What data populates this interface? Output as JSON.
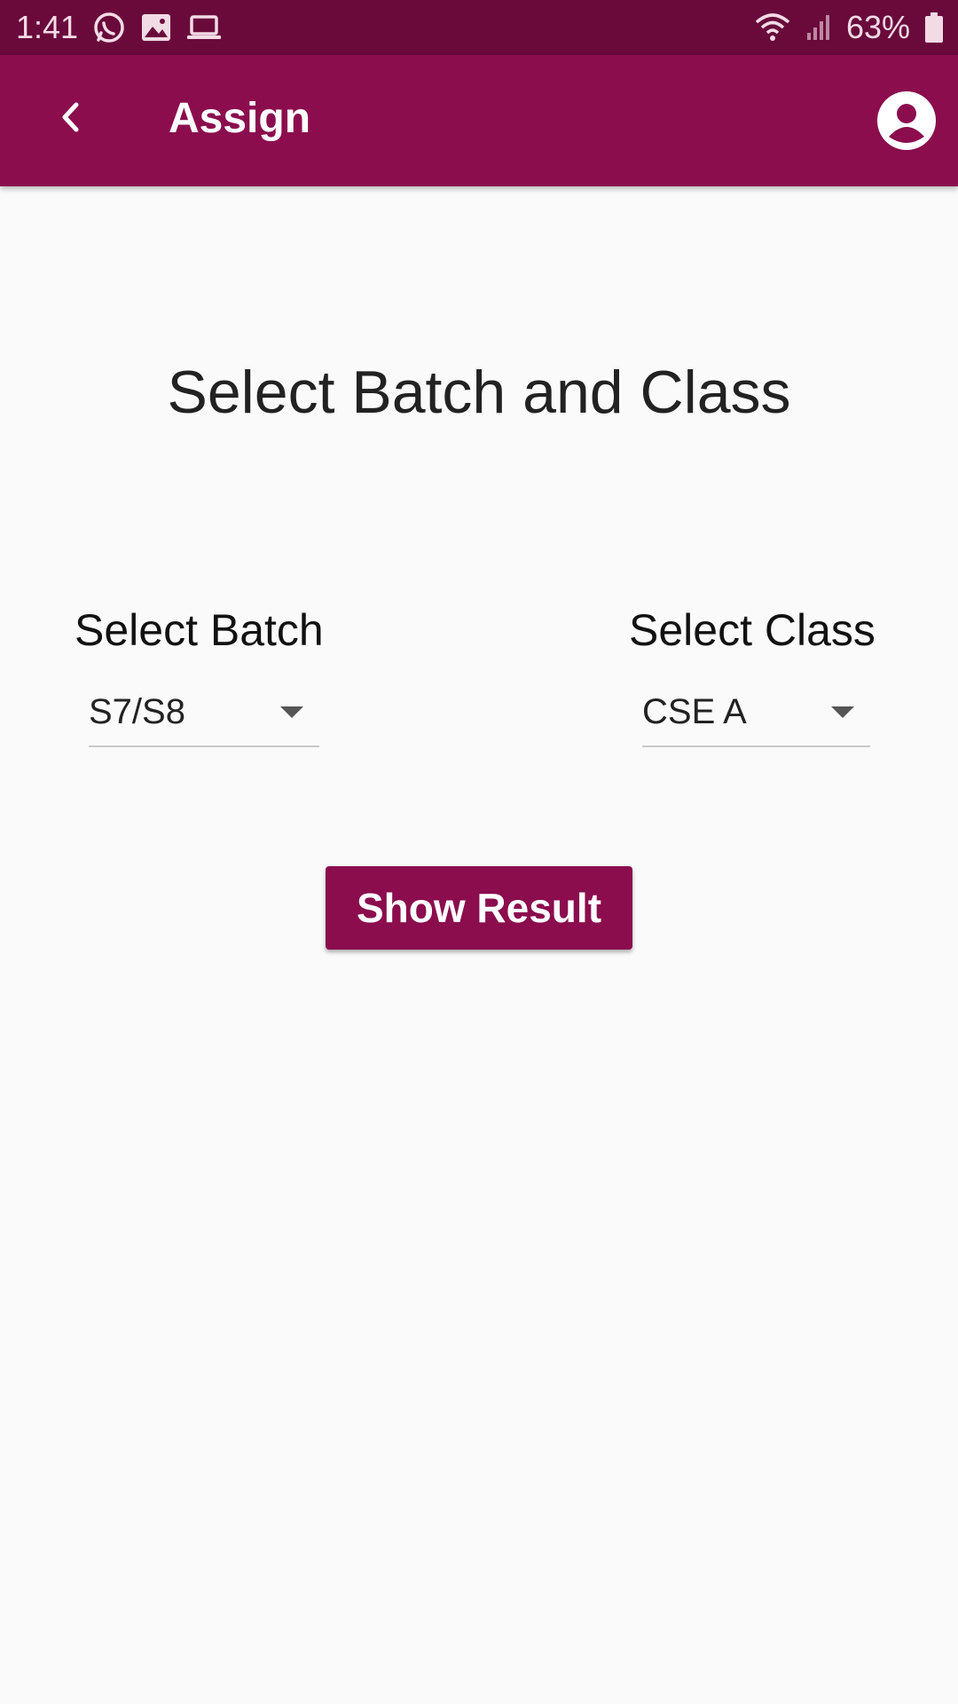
{
  "status_bar": {
    "time": "1:41",
    "battery_percent": "63%",
    "icons": [
      "whatsapp-icon",
      "gallery-icon",
      "laptop-icon",
      "wifi-icon",
      "signal-icon",
      "battery-icon"
    ]
  },
  "app_bar": {
    "title": "Assign",
    "back_icon": "chevron-left-icon",
    "profile_icon": "account-circle-icon"
  },
  "main": {
    "heading": "Select Batch and Class",
    "batch": {
      "label": "Select Batch",
      "selected": "S7/S8"
    },
    "class": {
      "label": "Select Class",
      "selected": "CSE A"
    },
    "show_result_label": "Show Result"
  },
  "colors": {
    "status_bar": "#690a3b",
    "primary": "#8b0d4e",
    "background": "#fafafa"
  }
}
